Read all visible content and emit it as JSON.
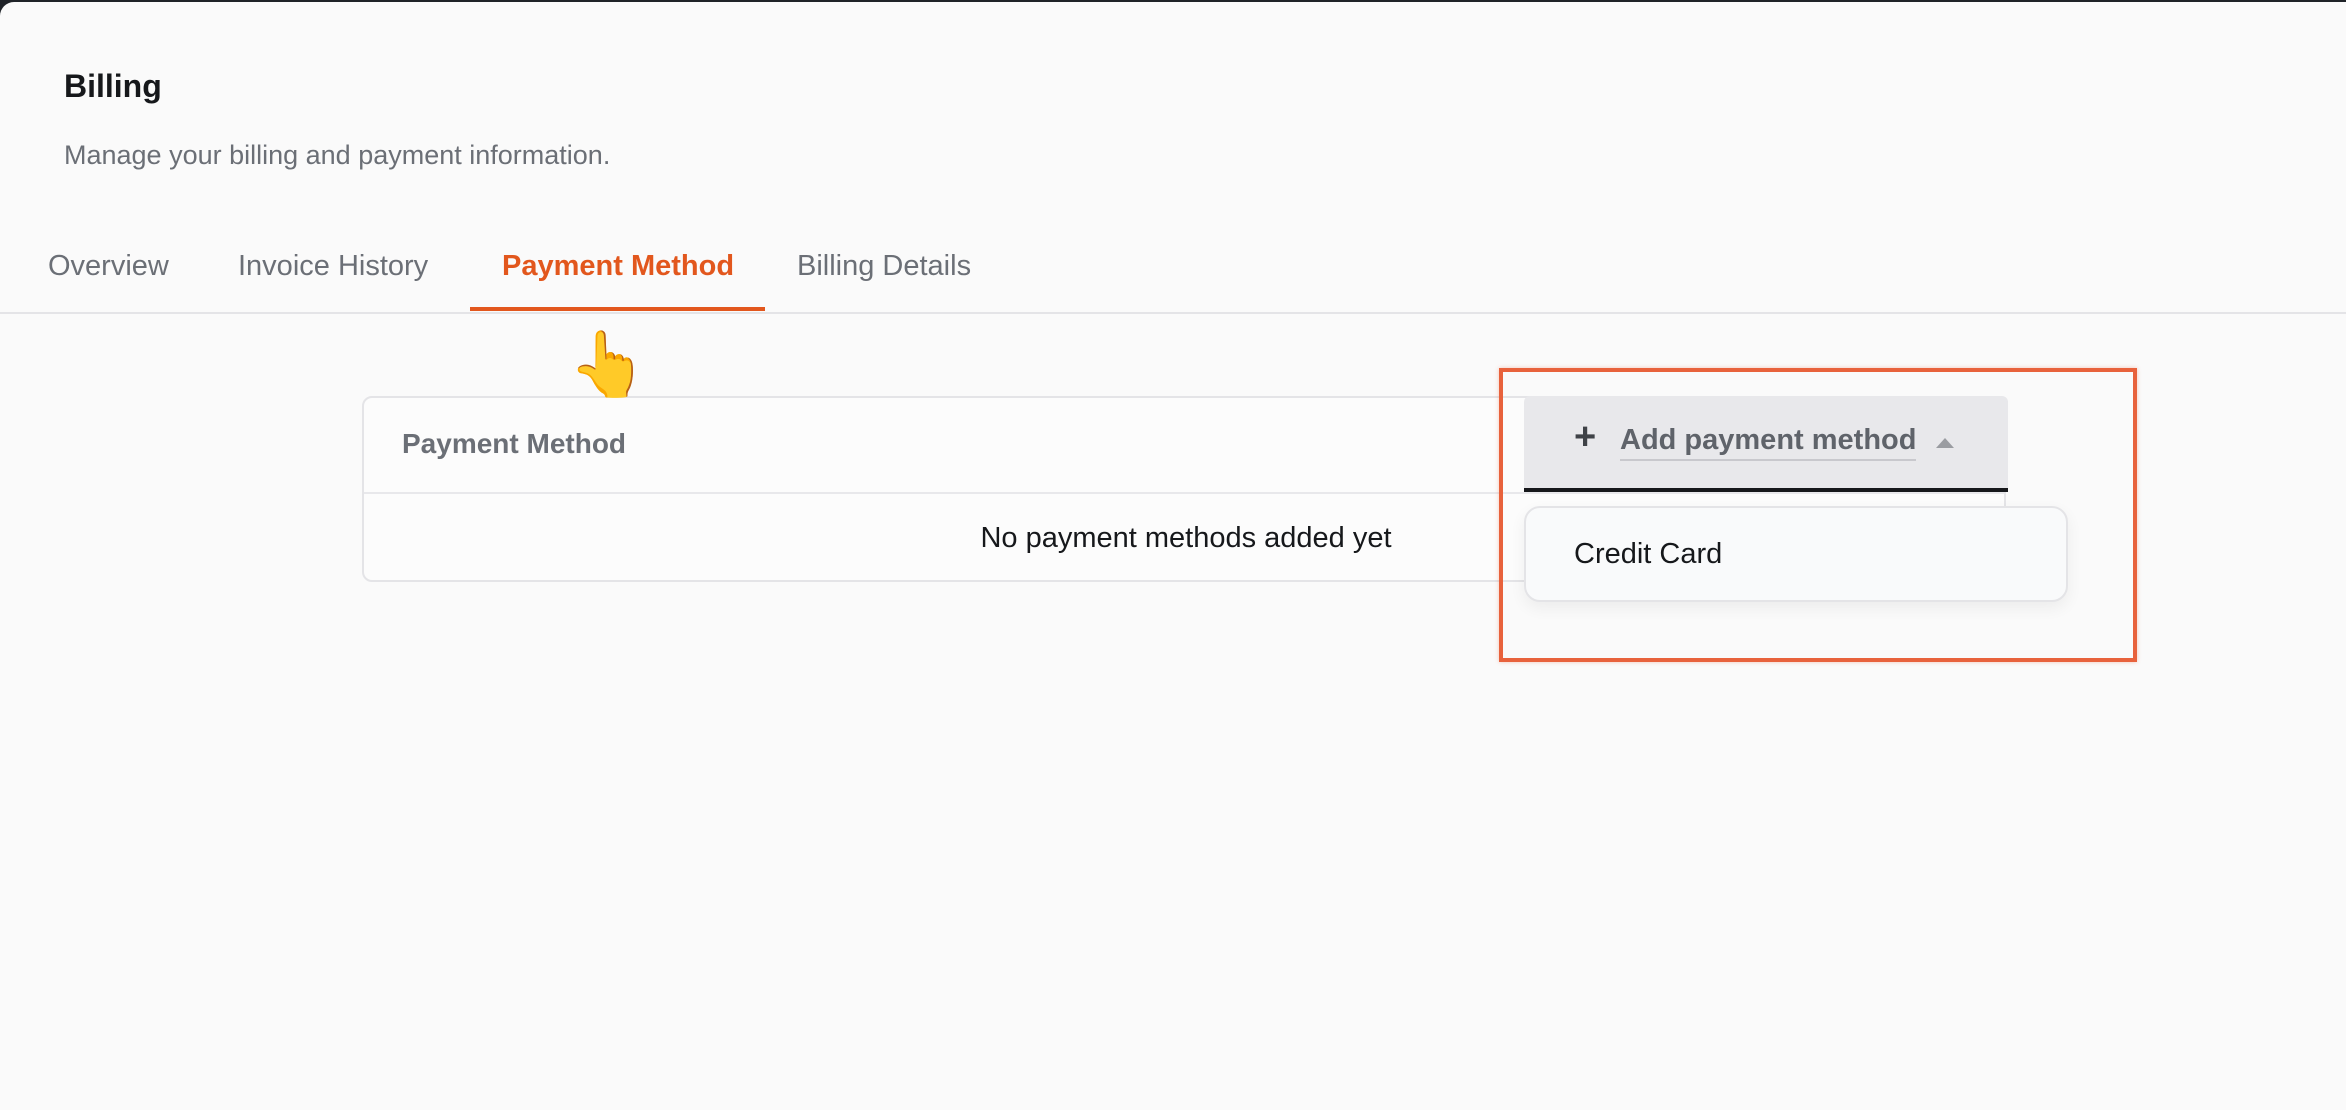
{
  "page": {
    "title": "Billing",
    "subtitle": "Manage your billing and payment information."
  },
  "tabs": [
    {
      "label": "Overview",
      "active": false
    },
    {
      "label": "Invoice History",
      "active": false
    },
    {
      "label": "Payment Method",
      "active": true
    },
    {
      "label": "Billing Details",
      "active": false
    }
  ],
  "payment_method_card": {
    "title": "Payment Method",
    "empty_text": "No payment methods added yet"
  },
  "add_payment_button": {
    "icon": "plus-icon",
    "plus_glyph": "+",
    "label": "Add payment method",
    "caret_icon": "caret-up-icon"
  },
  "dropdown": {
    "items": [
      {
        "label": "Credit Card"
      }
    ]
  },
  "pointer": {
    "icon": "pointing-hand-icon",
    "glyph": "👆"
  },
  "colors": {
    "accent": "#e2571d",
    "highlight": "#e8623c",
    "text_primary": "#16181b",
    "text_muted": "#6b6f76",
    "background": "#fafafa"
  }
}
